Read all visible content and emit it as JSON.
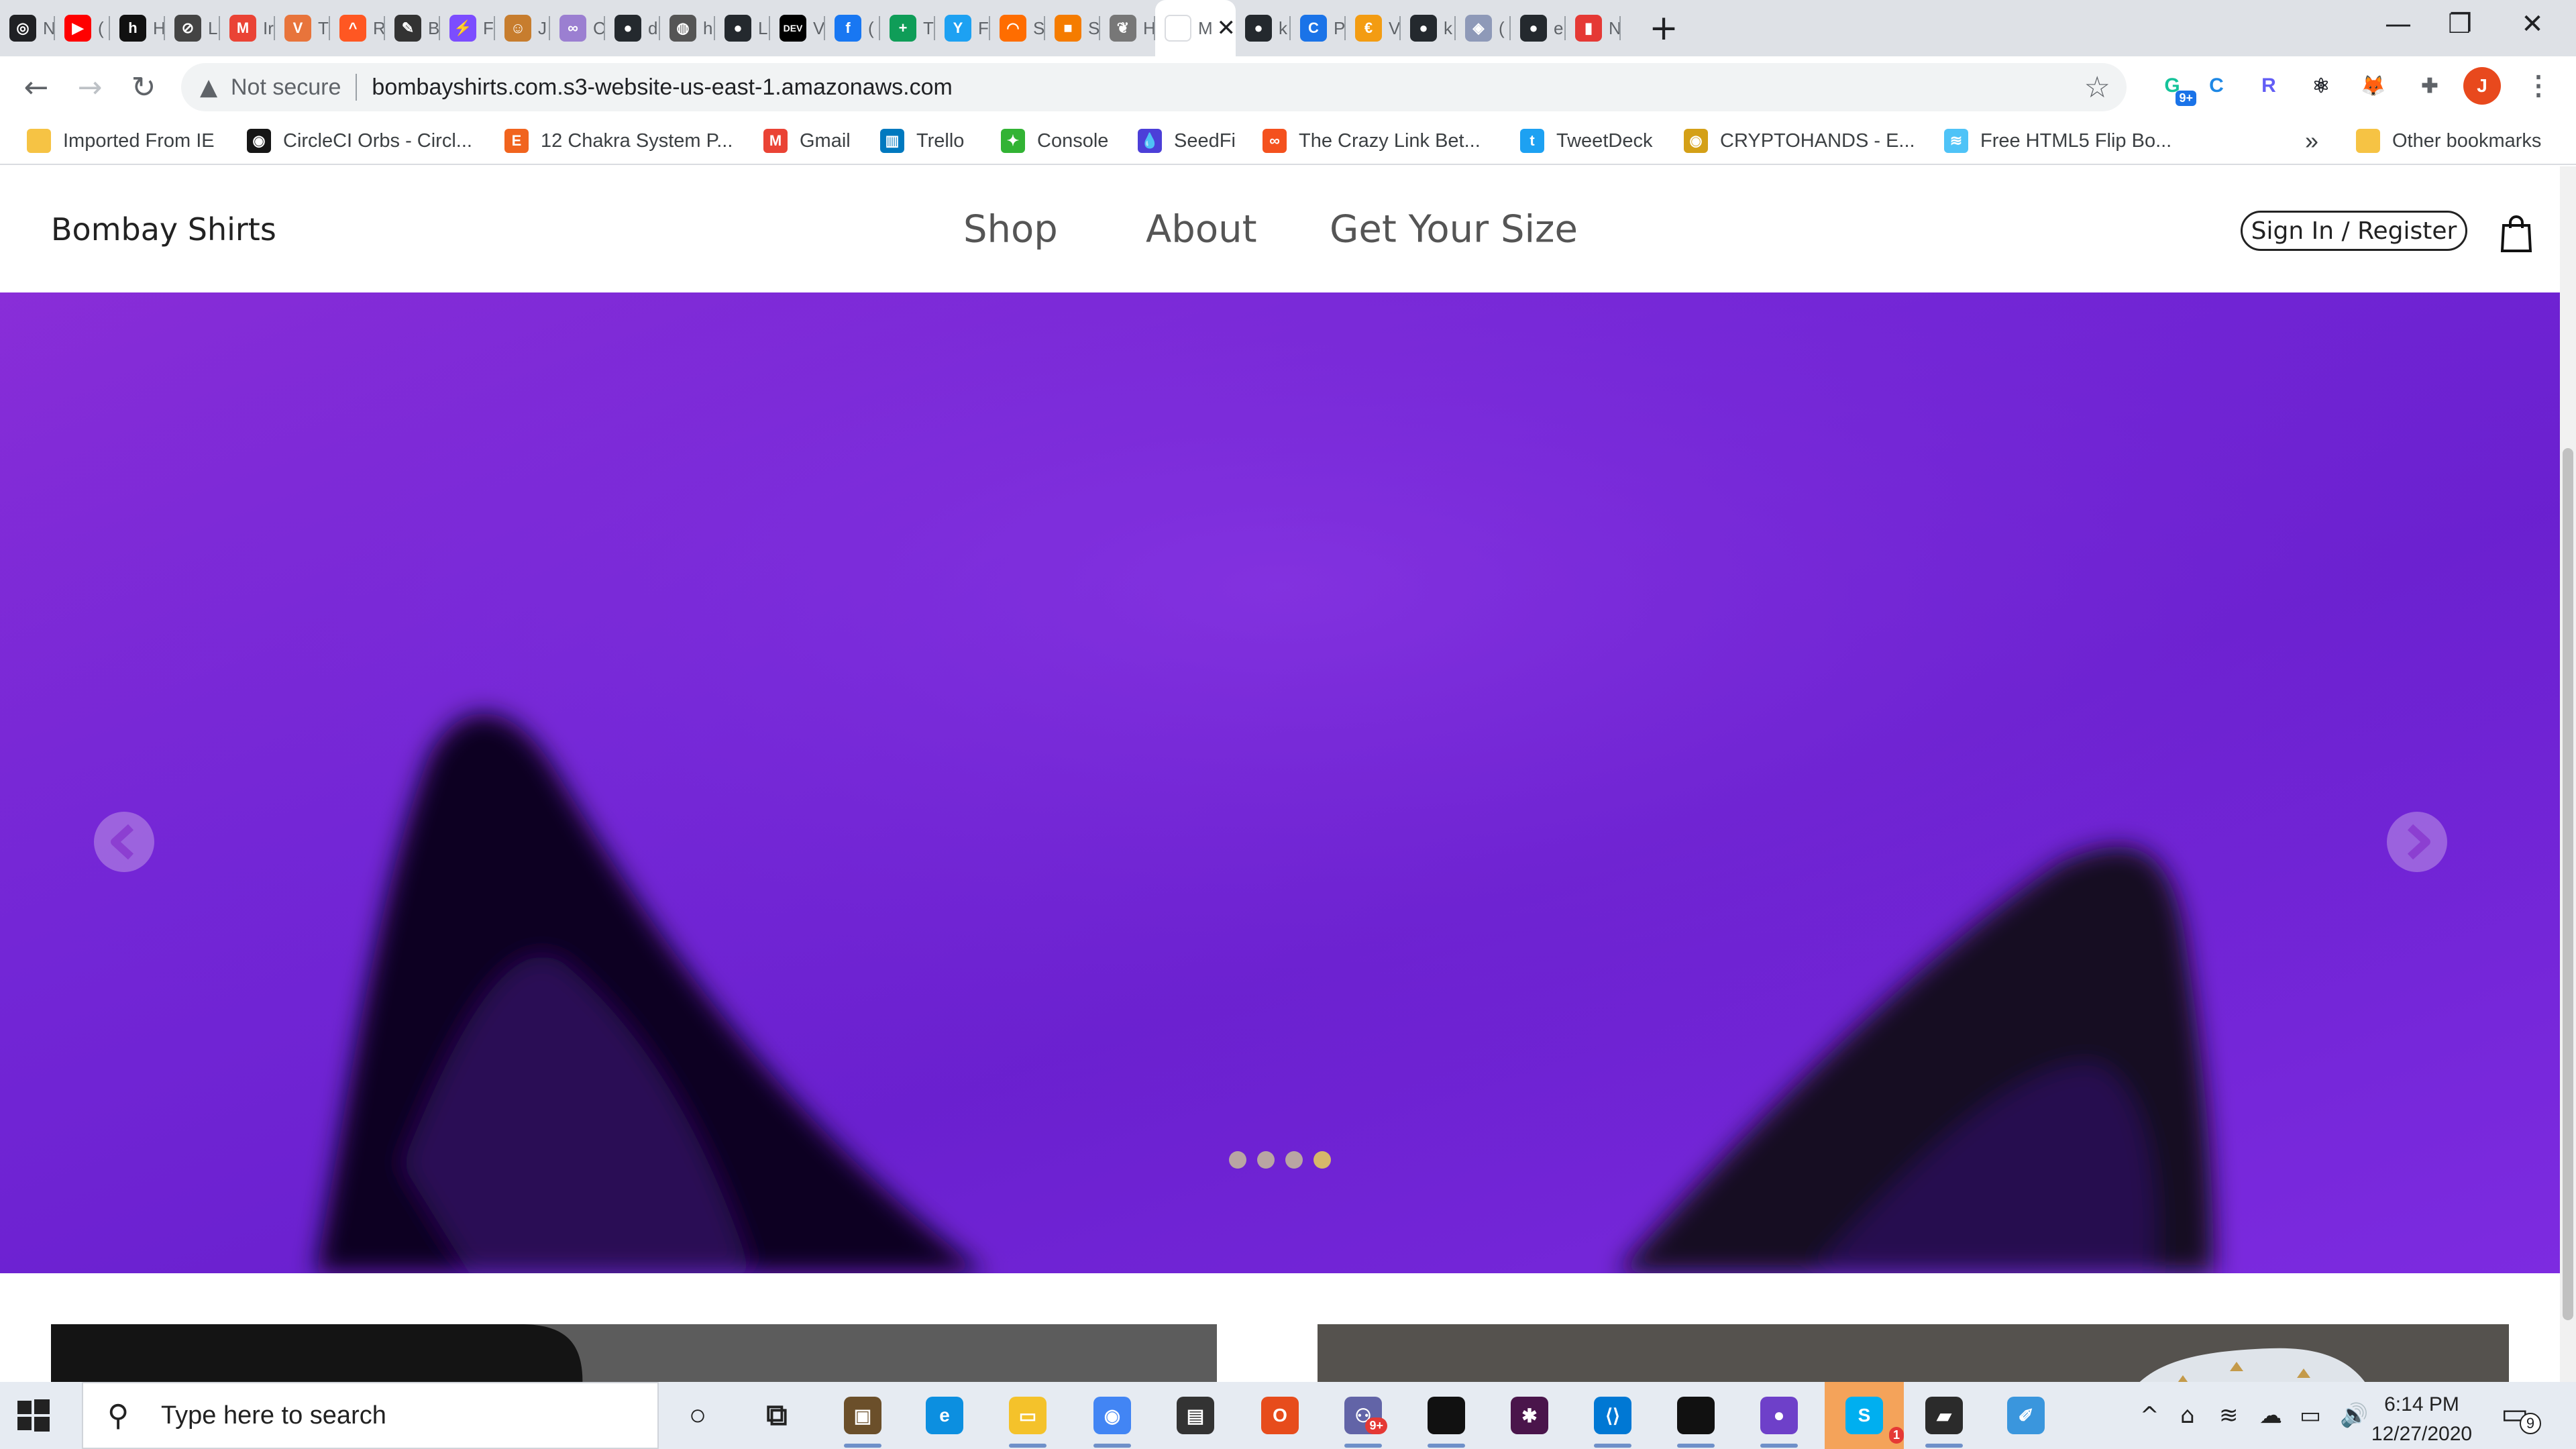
{
  "browser": {
    "tabs": [
      {
        "label": "N",
        "icon": "mask-icon",
        "color": "#202124",
        "glyph": "◎"
      },
      {
        "label": "(",
        "icon": "youtube-icon",
        "color": "#ff0000",
        "glyph": "▶"
      },
      {
        "label": "H",
        "icon": "h-logo-icon",
        "color": "#111111",
        "glyph": "h"
      },
      {
        "label": "L",
        "icon": "no-entry-icon",
        "color": "#444444",
        "glyph": "⊘"
      },
      {
        "label": "Ir",
        "icon": "gmail-icon",
        "color": "#ea4335",
        "glyph": "M"
      },
      {
        "label": "T",
        "icon": "v-logo-icon",
        "color": "#e8743b",
        "glyph": "V"
      },
      {
        "label": "R",
        "icon": "peak-icon",
        "color": "#ff5722",
        "glyph": "^"
      },
      {
        "label": "B",
        "icon": "pen-icon",
        "color": "#333333",
        "glyph": "✎"
      },
      {
        "label": "F",
        "icon": "bolt-icon",
        "color": "#7c4dff",
        "glyph": "⚡"
      },
      {
        "label": "J",
        "icon": "cowboy-icon",
        "color": "#c77d2e",
        "glyph": "☺"
      },
      {
        "label": "C",
        "icon": "circles-icon",
        "color": "#9b7fd1",
        "glyph": "∞"
      },
      {
        "label": "d",
        "icon": "github-icon",
        "color": "#24292e",
        "glyph": "●"
      },
      {
        "label": "h",
        "icon": "globe-icon",
        "color": "#555555",
        "glyph": "◍"
      },
      {
        "label": "L",
        "icon": "github-icon",
        "color": "#24292e",
        "glyph": "●"
      },
      {
        "label": "V",
        "icon": "dev-icon",
        "color": "#000000",
        "glyph": "DEV"
      },
      {
        "label": "(",
        "icon": "facebook-icon",
        "color": "#1877f2",
        "glyph": "f"
      },
      {
        "label": "T",
        "icon": "plus-square-icon",
        "color": "#0f9d58",
        "glyph": "+"
      },
      {
        "label": "F",
        "icon": "y-logo-icon",
        "color": "#1da1f2",
        "glyph": "Y"
      },
      {
        "label": "S",
        "icon": "rainbow-icon",
        "color": "#ff6d00",
        "glyph": "◠"
      },
      {
        "label": "S",
        "icon": "box-icon",
        "color": "#f57c00",
        "glyph": "■"
      },
      {
        "label": "H",
        "icon": "leaf-icon",
        "color": "#777777",
        "glyph": "❦"
      },
      {
        "label": "M",
        "icon": "blank-tab-icon",
        "color": "#ffffff",
        "glyph": ""
      },
      {
        "label": "k",
        "icon": "github-icon",
        "color": "#24292e",
        "glyph": "●"
      },
      {
        "label": "P",
        "icon": "c-logo-icon",
        "color": "#1a73e8",
        "glyph": "C"
      },
      {
        "label": "V",
        "icon": "coin-icon",
        "color": "#f39c12",
        "glyph": "€"
      },
      {
        "label": "k",
        "icon": "github-icon",
        "color": "#24292e",
        "glyph": "●"
      },
      {
        "label": "(",
        "icon": "cube-icon",
        "color": "#8e99b8",
        "glyph": "◈"
      },
      {
        "label": "e",
        "icon": "github-icon",
        "color": "#24292e",
        "glyph": "●"
      },
      {
        "label": "N",
        "icon": "bars-icon",
        "color": "#e53935",
        "glyph": "▮"
      }
    ],
    "active_tab_index": 21,
    "new_tab": "+",
    "window_controls": {
      "minimize": "—",
      "restore": "❐",
      "close": "✕"
    },
    "address": {
      "security": "Not secure",
      "url": "bombayshirts.com.s3-website-us-east-1.amazonaws.com"
    },
    "extensions": [
      {
        "icon": "grammarly-icon",
        "color": "#15c39a",
        "glyph": "G",
        "badge": "9+"
      },
      {
        "icon": "c-refresh-icon",
        "color": "#1e88e5",
        "glyph": "C"
      },
      {
        "icon": "loom-icon",
        "color": "#625df5",
        "glyph": "R"
      },
      {
        "icon": "react-icon",
        "color": "#20232a",
        "glyph": "⚛"
      },
      {
        "icon": "metamask-icon",
        "color": "#e2761b",
        "glyph": "🦊"
      },
      {
        "icon": "puzzle-icon",
        "color": "#5f6368",
        "glyph": "✚"
      }
    ],
    "profile_initial": "J",
    "profile_color": "#e8491d",
    "bookmarks": [
      {
        "label": "Imported From IE",
        "icon": "folder-icon",
        "color": "#f6c344",
        "glyph": ""
      },
      {
        "label": "CircleCI Orbs - Circl...",
        "icon": "circleci-icon",
        "color": "#161616",
        "glyph": "◉"
      },
      {
        "label": "12 Chakra System P...",
        "icon": "etsy-icon",
        "color": "#f1641e",
        "glyph": "E"
      },
      {
        "label": "Gmail",
        "icon": "gmail-icon",
        "color": "#ea4335",
        "glyph": "M"
      },
      {
        "label": "Trello",
        "icon": "trello-icon",
        "color": "#0079bf",
        "glyph": "▥"
      },
      {
        "label": "Console",
        "icon": "console-icon",
        "color": "#32b334",
        "glyph": "✦"
      },
      {
        "label": "SeedFi",
        "icon": "drop-icon",
        "color": "#4c3fd8",
        "glyph": "💧"
      },
      {
        "label": "The Crazy Link Bet...",
        "icon": "link-icon",
        "color": "#f4511e",
        "glyph": "∞"
      },
      {
        "label": "TweetDeck",
        "icon": "twitter-icon",
        "color": "#1da1f2",
        "glyph": "t"
      },
      {
        "label": "CRYPTOHANDS - E...",
        "icon": "eye-icon",
        "color": "#d4a017",
        "glyph": "◉"
      },
      {
        "label": "Free HTML5 Flip Bo...",
        "icon": "book-icon",
        "color": "#4fc3f7",
        "glyph": "≋"
      }
    ],
    "bookmarks_overflow": "»",
    "other_bookmarks": "Other bookmarks"
  },
  "site": {
    "brand": "Bombay Shirts",
    "nav": [
      "Shop",
      "About",
      "Get Your Size"
    ],
    "signin": "Sign In / Register",
    "carousel": {
      "slides": 4,
      "active_slide": 4,
      "prev": "‹",
      "next": "›",
      "accent": "#7326d6"
    }
  },
  "taskbar": {
    "search_placeholder": "Type here to search",
    "apps": [
      {
        "icon": "cortana-icon",
        "color": "#222222",
        "glyph": "○",
        "running": false
      },
      {
        "icon": "task-view-icon",
        "color": "#222222",
        "glyph": "⧉",
        "running": false
      },
      {
        "icon": "package-icon",
        "color": "#6b4f2a",
        "glyph": "▣",
        "running": true
      },
      {
        "icon": "edge-icon",
        "color": "#0c8fe0",
        "glyph": "e",
        "running": false
      },
      {
        "icon": "file-explorer-icon",
        "color": "#f4c22b",
        "glyph": "▭",
        "running": true
      },
      {
        "icon": "chrome-icon",
        "color": "#4285f4",
        "glyph": "◉",
        "running": true
      },
      {
        "icon": "store-icon",
        "color": "#333333",
        "glyph": "▤",
        "running": false
      },
      {
        "icon": "office-icon",
        "color": "#e74c1c",
        "glyph": "O",
        "running": false
      },
      {
        "icon": "teams-icon",
        "color": "#6264a7",
        "glyph": "⚇",
        "running": true,
        "badge": "9+"
      },
      {
        "icon": "terminal-icon",
        "color": "#111111",
        "glyph": "",
        "running": true
      },
      {
        "icon": "slack-icon",
        "color": "#4a154b",
        "glyph": "✱",
        "running": false
      },
      {
        "icon": "vscode-icon",
        "color": "#0078d4",
        "glyph": "⟨⟩",
        "running": true
      },
      {
        "icon": "terminal-icon",
        "color": "#111111",
        "glyph": "",
        "running": true
      },
      {
        "icon": "github-desktop-icon",
        "color": "#6e40c9",
        "glyph": "●",
        "running": true
      },
      {
        "icon": "skype-icon",
        "color": "#00aff0",
        "glyph": "S",
        "running": true,
        "badge": "1",
        "highlight": true
      },
      {
        "icon": "sticky-notes-icon",
        "color": "#2b2b2b",
        "glyph": "▰",
        "running": true
      },
      {
        "icon": "paint-icon",
        "color": "#3a96dd",
        "glyph": "✐",
        "running": false
      }
    ],
    "tray": [
      "^",
      "⌂",
      "≋",
      "☁",
      "▭",
      "🔊"
    ],
    "time": "6:14 PM",
    "date": "12/27/2020",
    "notifications": "9"
  }
}
